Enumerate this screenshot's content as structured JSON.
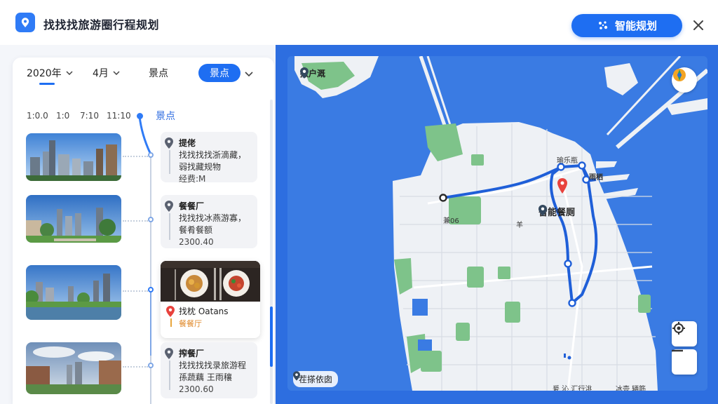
{
  "header": {
    "title": "找找找旅游圈行程规划",
    "plan_button": "智能规划",
    "icons": {
      "logo": "map-pin-logo-icon",
      "plan": "sparkle-icon",
      "close": "close-icon"
    }
  },
  "filters": {
    "year": "2020年",
    "month": "4月",
    "category": "景点",
    "active_chip": "景点"
  },
  "timeline": {
    "times": [
      "1:0.0",
      "1:0",
      "7:10",
      "11:10"
    ],
    "head_label": "景点"
  },
  "itinerary": [
    {
      "title": "提佬",
      "desc": "找找找找浙滴藏，弱找藏规物",
      "price": "经费:M",
      "thumb": "city-skyline"
    },
    {
      "title": "餐餐厂",
      "desc": "找找找冰燕游寡，餐肴餐额",
      "price": "2300.40",
      "thumb": "city-park"
    },
    {
      "title": "找枕 Oatans",
      "desc": "餐餐厅",
      "price": "",
      "thumb": "city-lake",
      "has_food_photo": true
    },
    {
      "title": "搾餐厂",
      "desc": "找找找找录旅游程 孫蔬藕 王雨穰",
      "price": "2300.60",
      "thumb": "city-plaza"
    }
  ],
  "map": {
    "labels": {
      "north": "撒户溉",
      "poi": "智能餐厕",
      "east_top": "瑜乐瓶",
      "east_right": "雨栖",
      "west": "兼06",
      "center": "羊",
      "bottom_right_a": "爰 沁 汇行洮",
      "bottom_right_b": "冰壶 辆筋",
      "bottom_chip": "茬搽依囱"
    },
    "icons": {
      "north": "location-pin-icon",
      "poi": "location-pin-icon",
      "compass": "compass-logo-icon",
      "locate": "locate-icon",
      "zoom_out": "minus-icon",
      "bottom": "location-pin-icon"
    },
    "colors": {
      "water": "#3a7be3",
      "land": "#eef1f5",
      "park": "#7ec38a",
      "route": "#1f5fd8",
      "marker": "#e8423d"
    }
  }
}
